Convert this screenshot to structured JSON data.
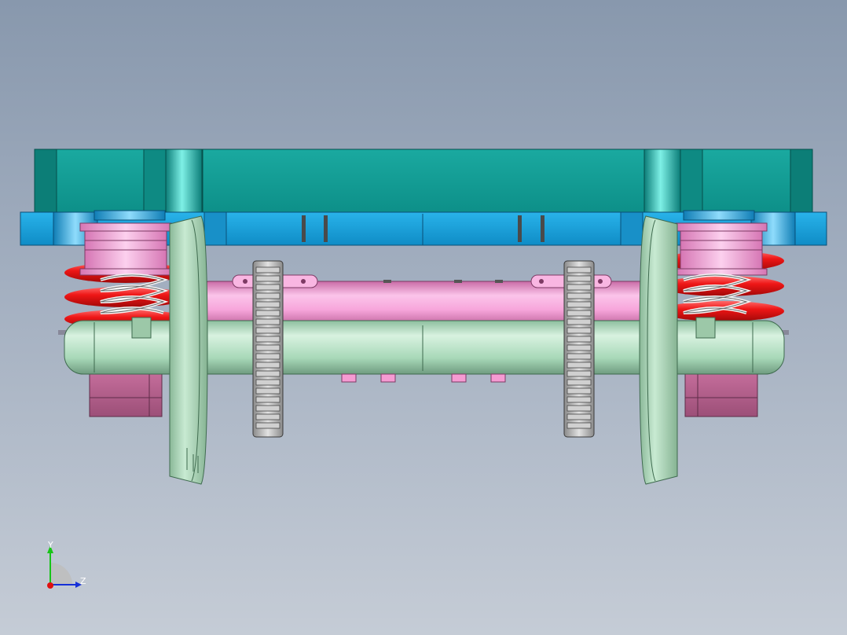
{
  "view": {
    "background_top": "#8898ad",
    "background_bottom": "#c5ccd6"
  },
  "model": {
    "parts": [
      {
        "name": "upper-frame",
        "color": "#139e96"
      },
      {
        "name": "bolster-plate",
        "color": "#1aa0d8"
      },
      {
        "name": "axle-box-pink",
        "color": "#f59bd2"
      },
      {
        "name": "coil-spring-red",
        "color": "#ee1616"
      },
      {
        "name": "coil-spring-grey",
        "color": "#d8d8d8"
      },
      {
        "name": "traction-rod-pink",
        "color": "#f7a6db"
      },
      {
        "name": "wheelset-axle",
        "color": "#a8d8b8"
      },
      {
        "name": "wheel",
        "color": "#a6d2b2"
      },
      {
        "name": "gear",
        "color": "#b9b9b9"
      },
      {
        "name": "lower-mount",
        "color": "#b96090"
      }
    ]
  },
  "triad": {
    "y_label": "Y",
    "z_label": "Z",
    "y_color": "#18c418",
    "z_color": "#1530d8",
    "x_color": "#e01010"
  }
}
